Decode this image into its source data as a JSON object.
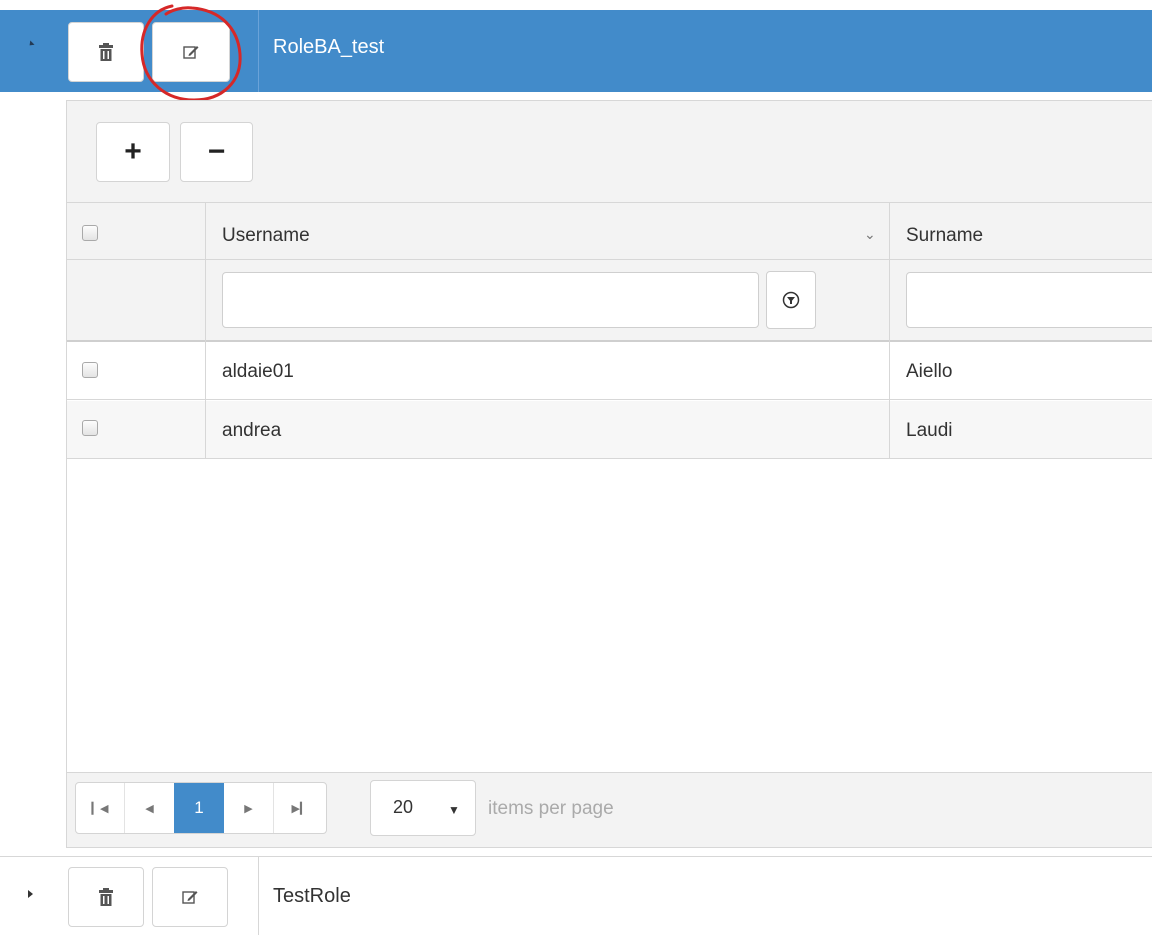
{
  "roles": [
    {
      "name": "RoleBA_test",
      "expanded": true,
      "delete_icon": "trash-icon",
      "edit_icon": "edit-icon"
    },
    {
      "name": "TestRole",
      "expanded": false,
      "delete_icon": "trash-icon",
      "edit_icon": "edit-icon"
    }
  ],
  "toolbar": {
    "add_label": "+",
    "remove_label": "−"
  },
  "grid": {
    "columns": [
      "Username",
      "Surname"
    ],
    "filter_values": [
      "",
      ""
    ],
    "rows": [
      {
        "username": "aldaie01",
        "surname": "Aiello"
      },
      {
        "username": "andrea",
        "surname": "Laudi"
      }
    ]
  },
  "pager": {
    "current_page": "1",
    "page_size": "20",
    "items_per_page_label": "items per page"
  },
  "colors": {
    "selected_row": "#428bca",
    "annotation": "#d62828"
  }
}
